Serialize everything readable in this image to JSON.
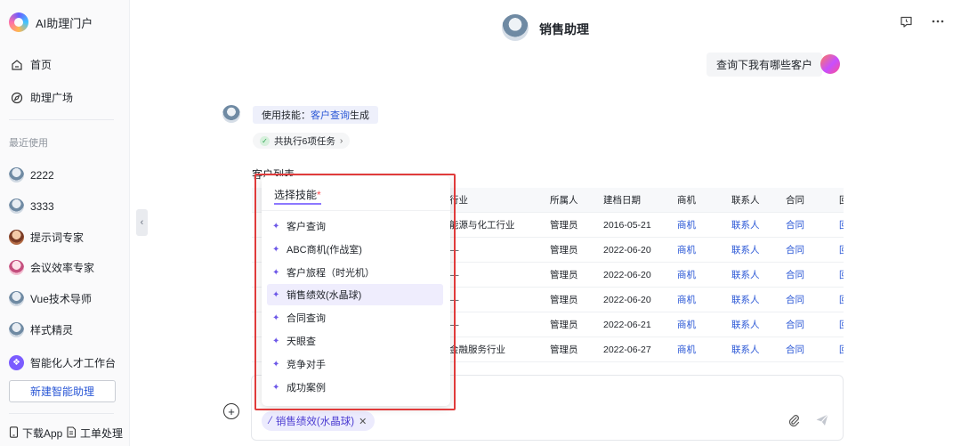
{
  "app": {
    "name": "AI助理门户"
  },
  "nav": {
    "home": "首页",
    "plaza": "助理广场",
    "recent_label": "最近使用"
  },
  "recent": [
    {
      "label": "2222",
      "icon": "robot-avatar"
    },
    {
      "label": "3333",
      "icon": "robot-avatar"
    },
    {
      "label": "提示词专家",
      "icon": "expert-avatar"
    },
    {
      "label": "会议效率专家",
      "icon": "woman-avatar"
    },
    {
      "label": "Vue技术导师",
      "icon": "robot-avatar"
    },
    {
      "label": "样式精灵",
      "icon": "robot-avatar"
    },
    {
      "label": "智能化人才工作台",
      "icon": "workbench-icon"
    }
  ],
  "sidebar": {
    "new_assistant": "新建智能助理",
    "download_app": "下载App",
    "ticket": "工单处理"
  },
  "header": {
    "title": "销售助理"
  },
  "chat": {
    "user_message": "查询下我有哪些客户",
    "skill_prefix": "使用技能：",
    "skill_name": "客户查询",
    "skill_suffix": "生成",
    "tasks": "共执行6项任务",
    "list_title": "客户列表"
  },
  "table": {
    "headers": [
      "行业",
      "所属人",
      "建档日期",
      "商机",
      "联系人",
      "合同",
      "回"
    ],
    "rows": [
      [
        "能源与化工行业",
        "管理员",
        "2016-05-21",
        "商机",
        "联系人",
        "合同",
        "回"
      ],
      [
        "—",
        "管理员",
        "2022-06-20",
        "商机",
        "联系人",
        "合同",
        "回"
      ],
      [
        "—",
        "管理员",
        "2022-06-20",
        "商机",
        "联系人",
        "合同",
        "回"
      ],
      [
        "—",
        "管理员",
        "2022-06-20",
        "商机",
        "联系人",
        "合同",
        "回"
      ],
      [
        "—",
        "管理员",
        "2022-06-21",
        "商机",
        "联系人",
        "合同",
        "回"
      ],
      [
        "金融服务行业",
        "管理员",
        "2022-06-27",
        "商机",
        "联系人",
        "合同",
        "回"
      ]
    ]
  },
  "dropdown": {
    "title": "选择技能",
    "required_mark": "*",
    "items": [
      "客户查询",
      "ABC商机(作战室)",
      "客户旅程（时光机）",
      "销售绩效(水晶球)",
      "合同查询",
      "天眼查",
      "竞争对手",
      "成功案例"
    ],
    "active_index": 3
  },
  "input": {
    "selected_skill": "销售绩效(水晶球)"
  },
  "colors": {
    "accent": "#2a57d6",
    "skill_purple": "#6d58e8",
    "highlight_red": "#e03b3b"
  }
}
